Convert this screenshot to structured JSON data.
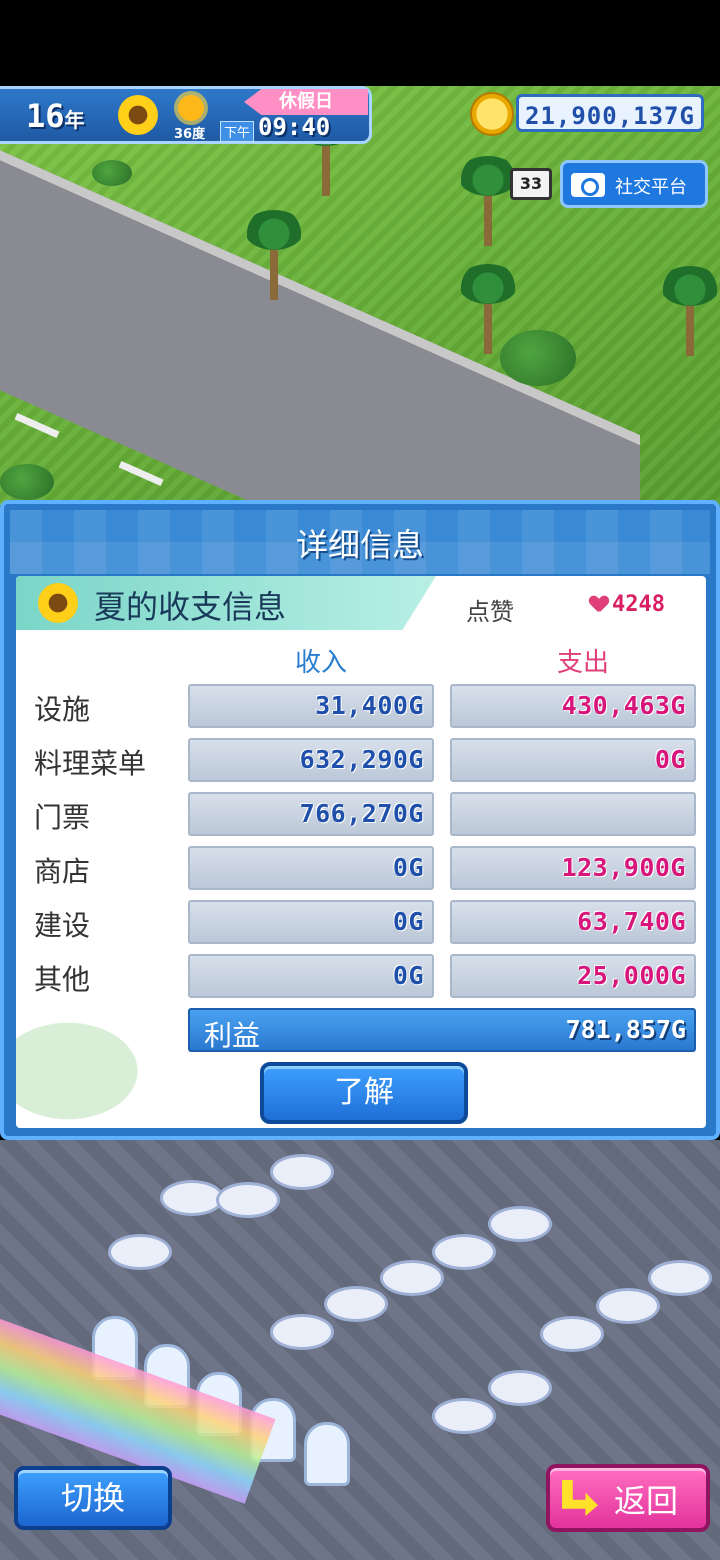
{
  "hud": {
    "year_number": "16",
    "year_unit": "年",
    "temperature": "36度",
    "ampm": "下午",
    "time": "09:40",
    "holiday": "休假日",
    "money": "21,900,137G",
    "calendar_label": "33",
    "social_button": "社交平台"
  },
  "panel": {
    "title": "详细信息",
    "season_title": "夏的收支信息",
    "likes_label": "点赞",
    "likes_value": "4248",
    "income_header": "收入",
    "expense_header": "支出",
    "rows": [
      {
        "label": "设施",
        "income": "31,400G",
        "expense": "430,463G"
      },
      {
        "label": "料理菜单",
        "income": "632,290G",
        "expense": "0G"
      },
      {
        "label": "门票",
        "income": "766,270G",
        "expense": ""
      },
      {
        "label": "商店",
        "income": "0G",
        "expense": "123,900G"
      },
      {
        "label": "建设",
        "income": "0G",
        "expense": "63,740G"
      },
      {
        "label": "其他",
        "income": "0G",
        "expense": "25,000G"
      }
    ],
    "profit_label": "利益",
    "profit_value": "781,857G",
    "learn_button": "了解"
  },
  "bottom": {
    "switch_button": "切换",
    "back_button": "返回"
  },
  "colors": {
    "income_text": "#1e4faa",
    "expense_text": "#d8157a",
    "panel_blue": "#2a78c8",
    "back_pink": "#e2339b"
  },
  "icons": [
    "sunflower-icon",
    "sun-icon",
    "coin-icon",
    "calendar-icon",
    "camera-icon",
    "heart-icon",
    "back-arrow-icon"
  ]
}
